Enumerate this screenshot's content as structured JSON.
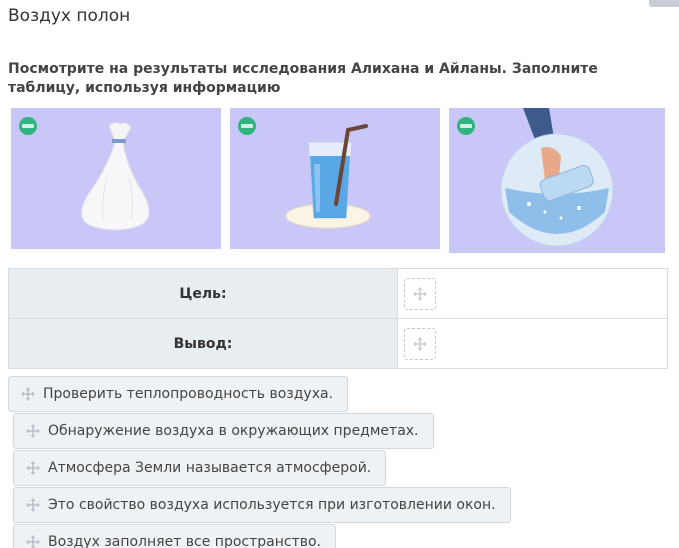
{
  "page": {
    "title": "Воздух полон"
  },
  "instruction": "Посмотрите на результаты исследования Алихана и Айланы. Заполните таблицу, используя информацию",
  "images": [
    {
      "icon": "plastic-bag",
      "badge": "BILIMLand"
    },
    {
      "icon": "glass-of-water-with-straw",
      "badge": "BILIMLand"
    },
    {
      "icon": "glass-in-bowl-of-water",
      "badge": "BILIMLand"
    }
  ],
  "table": {
    "rows": [
      {
        "label": "Цель:"
      },
      {
        "label": "Вывод:"
      }
    ]
  },
  "options": [
    "Проверить теплопроводность воздуха.",
    "Обнаружение воздуха в окружающих предметах.",
    "Атмосфера Земли называется атмосферой.",
    "Это свойство воздуха используется при изготовлении окон.",
    "Воздух заполняет все пространство."
  ],
  "colors": {
    "image_bg": "#c9c7f7",
    "label_cell_bg": "#e8edf1",
    "chip_bg": "#eef2f5",
    "badge": "#2fb37f"
  }
}
